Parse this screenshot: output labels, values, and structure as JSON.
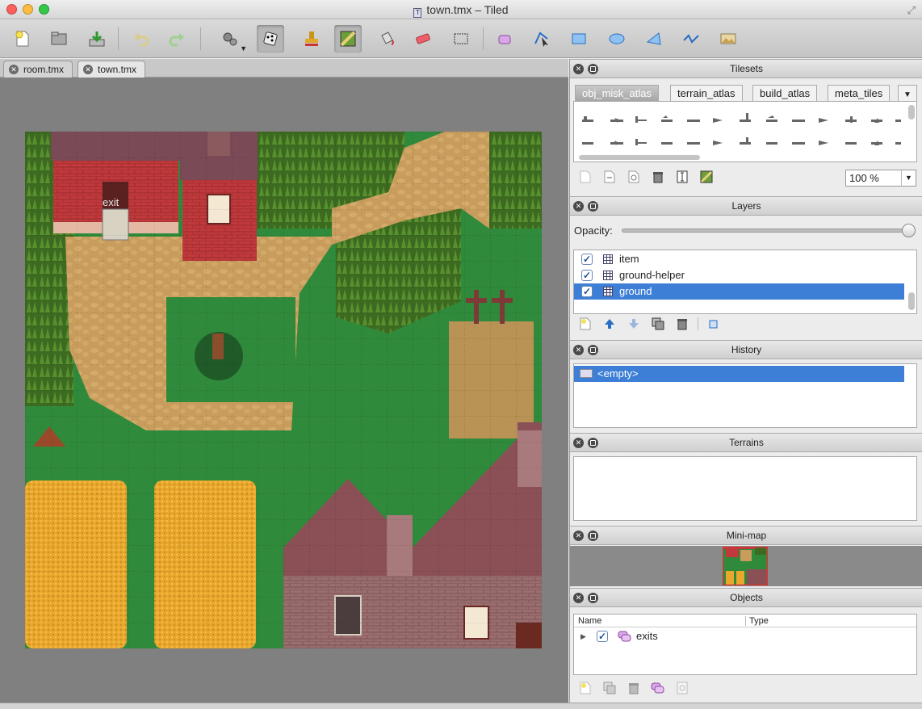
{
  "window": {
    "title": "town.tmx – Tiled"
  },
  "toolbar": {
    "tools": [
      "new-map",
      "open",
      "save",
      "undo",
      "redo",
      "random-stamp",
      "dice",
      "stamp-brush",
      "terrain-brush",
      "bucket-fill",
      "eraser",
      "rect-select",
      "select-objects",
      "edit-polygons",
      "insert-rectangle",
      "insert-ellipse",
      "insert-polygon",
      "insert-polyline",
      "insert-tile"
    ]
  },
  "tabs": [
    {
      "label": "room.tmx",
      "selected": false
    },
    {
      "label": "town.tmx",
      "selected": true
    }
  ],
  "map": {
    "exit_label": "exit"
  },
  "panels": {
    "tilesets": {
      "title": "Tilesets",
      "tabs": [
        "obj_misk_atlas",
        "terrain_atlas",
        "build_atlas",
        "meta_tiles"
      ],
      "selected_tab": "obj_misk_atlas",
      "zoom": "100 %"
    },
    "layers": {
      "title": "Layers",
      "opacity_label": "Opacity:",
      "opacity_value": 1.0,
      "items": [
        {
          "name": "item",
          "visible": true,
          "selected": false
        },
        {
          "name": "ground-helper",
          "visible": true,
          "selected": false
        },
        {
          "name": "ground",
          "visible": true,
          "selected": true
        }
      ]
    },
    "history": {
      "title": "History",
      "items": [
        "<empty>"
      ]
    },
    "terrains": {
      "title": "Terrains"
    },
    "minimap": {
      "title": "Mini-map"
    },
    "objects": {
      "title": "Objects",
      "col_name": "Name",
      "col_type": "Type",
      "items": [
        {
          "name": "exits",
          "visible": true
        }
      ]
    }
  },
  "colors": {
    "selection": "#3d7fd6",
    "grass": "#2e8b3a",
    "dirt": "#c69c58",
    "forest": "#3f6a22",
    "roof": "#8a5055",
    "brick": "#c0393c"
  }
}
